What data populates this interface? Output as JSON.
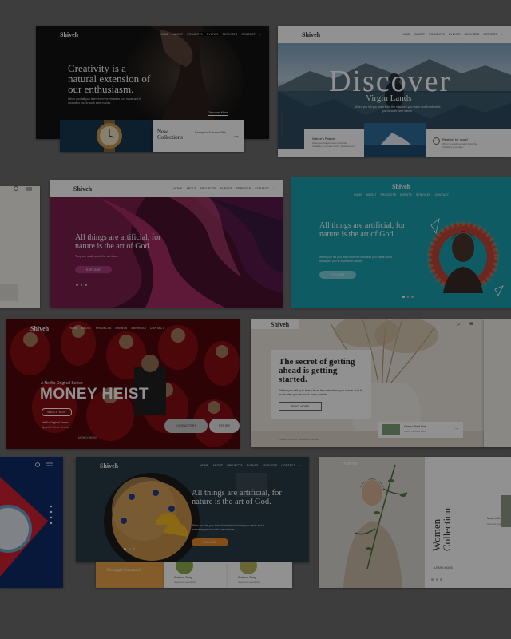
{
  "brand": "Shiveh",
  "menu": [
    "HOME",
    "ABOUT",
    "PROJECTS",
    "EVENTS",
    "SERVICES",
    "CONTACT"
  ],
  "cards": {
    "creativity": {
      "headline": "Creativity is a natural extension of our enthusiasm.",
      "body": "When you fail you learn from the mistakes you made and it motivates you to work even harder.",
      "discover": "Discover More",
      "collection_title": "New Collections",
      "collection_sub": "Exemption Summer Offer"
    },
    "discover": {
      "headline": "Discover",
      "sub": "Virgin Lands",
      "body": "When you fail you learn from the mistakes you made and it motivates you to work even harder.",
      "side_text": "Scroll down to explore",
      "box1_title": "Nature's Palace",
      "box1_body": "When you fail you learn from the mistakes you made and it motivates you.",
      "box2_title": "Register for more!",
      "box2_body": "When you fail you learn from the mistakes you made."
    },
    "canyon": {
      "headline": "All things are artificial, for nature is the art of God.",
      "sub": "They are really useful for our lives.",
      "button": "EXPLORE"
    },
    "teal": {
      "headline": "All things are artificial, for nature is the art of God.",
      "body": "When you fail you learn from the mistakes you made and it motivates you to work even harder.",
      "button": "EXPLORE"
    },
    "heist": {
      "tag": "A Netflix Original Series",
      "title": "MONEY HEIST",
      "button": "WATCH NOW",
      "meta1": "Netflix Original Series",
      "meta2": "Spanish Crime Drama",
      "char1": "CHORACTERS",
      "char2": "SERIES",
      "footer": "MONEY HEIST"
    },
    "secret": {
      "headline": "The secret of getting ahead is getting started.",
      "body": "When you fail you learn from the mistakes you made and it motivates you to work even harder.",
      "button": "READ MORE",
      "card_title": "Green Plant Pot",
      "card_sub": "Indoor plants & decor",
      "caption": "VASE & DECOR · DRIED FLOWERS"
    },
    "food": {
      "headline": "All things are artificial, for nature is the art of God.",
      "body": "When you fail you learn from the mistakes you made and it motivates you to work even harder.",
      "button": "EXPLORE",
      "dish1": "Pineapple Gunnatook",
      "dish2": "Autumn Soup",
      "dish2_sub": "Seasonal vegetables",
      "dish3": "Autumn Soup",
      "dish3_sub": "Seasonal vegetables"
    },
    "women": {
      "vertical": "Women Collection",
      "link": "LEARN MORE",
      "side_title": "Modern Co",
      "side_sub": "Summer Sale"
    }
  },
  "colors": {
    "overlay": "#000000",
    "teal": "#1aa1b0",
    "canyon": "#7a1f4d",
    "heist_red": "#b5121b",
    "food_orange": "#e88a2d"
  }
}
